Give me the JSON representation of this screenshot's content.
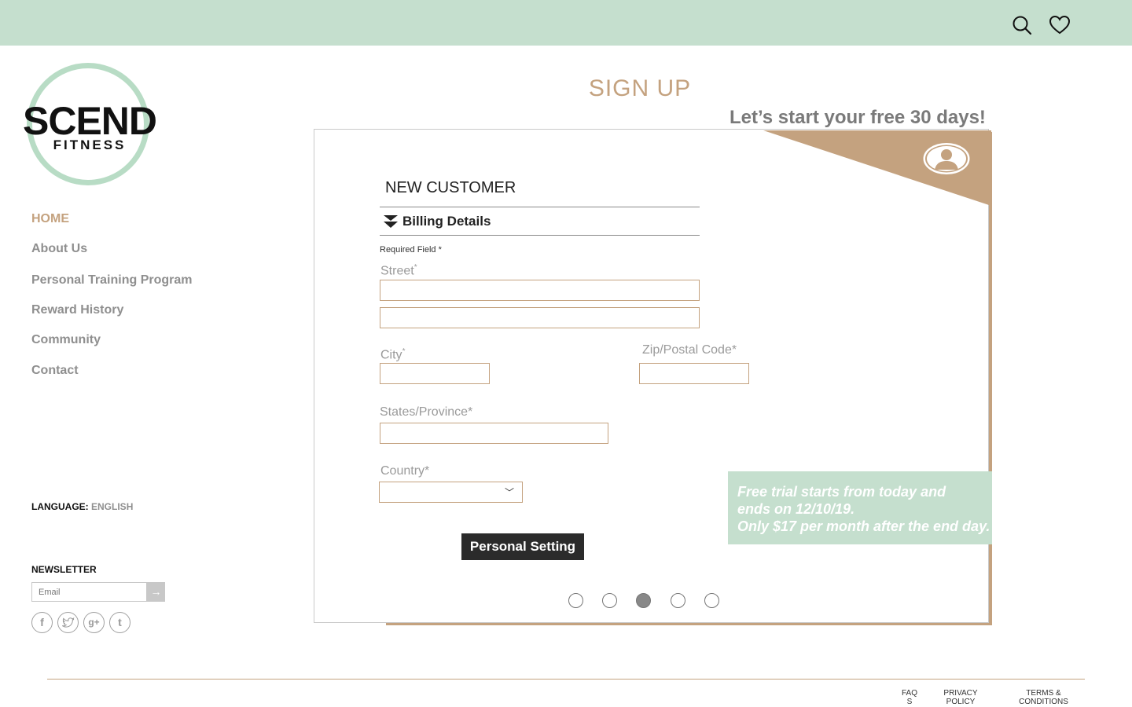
{
  "header": {
    "icons": [
      "search-icon",
      "heart-icon"
    ],
    "bg_color": "#c5dfce"
  },
  "logo": {
    "main": "SCEND",
    "sub": "FITNESS"
  },
  "nav": {
    "items": [
      {
        "label": "HOME",
        "active": true
      },
      {
        "label": "About Us"
      },
      {
        "label": "Personal Training Program"
      },
      {
        "label": "Reward History"
      },
      {
        "label": "Community"
      },
      {
        "label": "Contact"
      }
    ]
  },
  "language": {
    "label": "LANGUAGE:",
    "value": "ENGLISH"
  },
  "newsletter": {
    "title": "NEWSLETTER",
    "placeholder": "Email",
    "submit_icon": "arrow-right-icon"
  },
  "social": [
    "facebook-icon",
    "twitter-icon",
    "google-plus-icon",
    "tumblr-icon"
  ],
  "page": {
    "title": "SIGN UP",
    "tagline": "Let’s start your free 30 days!"
  },
  "form": {
    "section_title": "NEW CUSTOMER",
    "subsection": "Billing Details",
    "required_note": "Required Field *",
    "street_label": "Street",
    "city_label": "City",
    "zip_label": "Zip/Postal Code*",
    "state_label": "States/Province*",
    "country_label": "Country*",
    "country_value": "",
    "submit_label": "Personal Setting"
  },
  "promo": {
    "line1": "Free trial starts from today and",
    "line2": "ends on 12/10/19.",
    "line3": "Only $17 per month after the end day."
  },
  "pager": {
    "count": 5,
    "active_index": 2
  },
  "footer": {
    "links": [
      {
        "line1": "FAQ",
        "line2": "S"
      },
      {
        "line1": "PRIVACY",
        "line2": "POLICY"
      },
      {
        "line1": "TERMS &",
        "line2": "CONDITIONS"
      }
    ]
  },
  "colors": {
    "accent": "#c4a27f",
    "mint": "#c5dfce",
    "nav_gray": "#8f8f8f",
    "button_dark": "#2b2b2b"
  }
}
